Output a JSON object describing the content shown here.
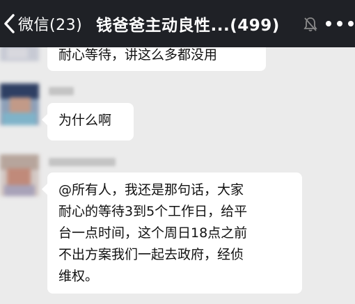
{
  "header": {
    "back_label": "微信(23)",
    "title": "钱爸爸主动良性...(499)",
    "mute_icon": "bell-mute-icon",
    "more_icon": "more-dots-icon"
  },
  "messages": [
    {
      "lines": [
        "耐心等待，讲这么多都没用"
      ]
    },
    {
      "lines": [
        "为什么啊"
      ]
    },
    {
      "lines": [
        "@所有人，我还是那句话，大家",
        "耐心的等待3到5个工作日，给平",
        "台一点时间，这个周日18点之前",
        "不出方案我们一起去政府，经侦",
        "维权。"
      ]
    }
  ],
  "colors": {
    "header_bg": "#1f2126",
    "chat_bg": "#ebebeb",
    "bubble_bg": "#ffffff"
  }
}
